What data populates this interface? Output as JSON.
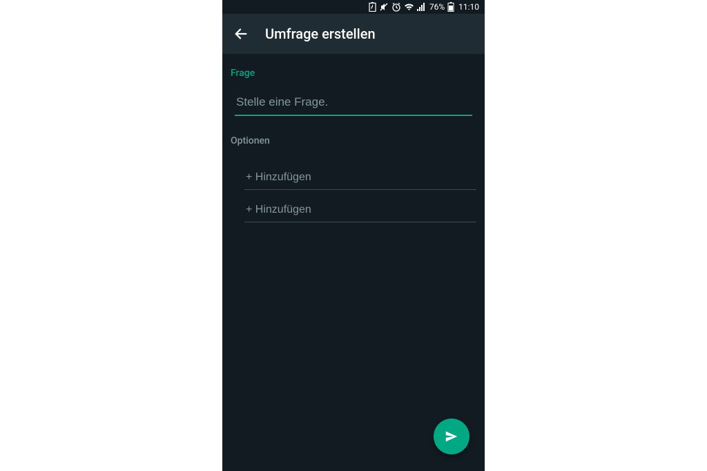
{
  "status_bar": {
    "battery_text": "76%",
    "time": "11:10"
  },
  "app_bar": {
    "title": "Umfrage erstellen"
  },
  "question": {
    "label": "Frage",
    "placeholder": "Stelle eine Frage.",
    "value": ""
  },
  "options": {
    "label": "Optionen",
    "items": [
      {
        "placeholder": "+ Hinzufügen",
        "value": ""
      },
      {
        "placeholder": "+ Hinzufügen",
        "value": ""
      }
    ]
  },
  "colors": {
    "accent": "#00a884",
    "bg": "#111b21",
    "bar": "#202c33",
    "muted": "#8696a0"
  }
}
